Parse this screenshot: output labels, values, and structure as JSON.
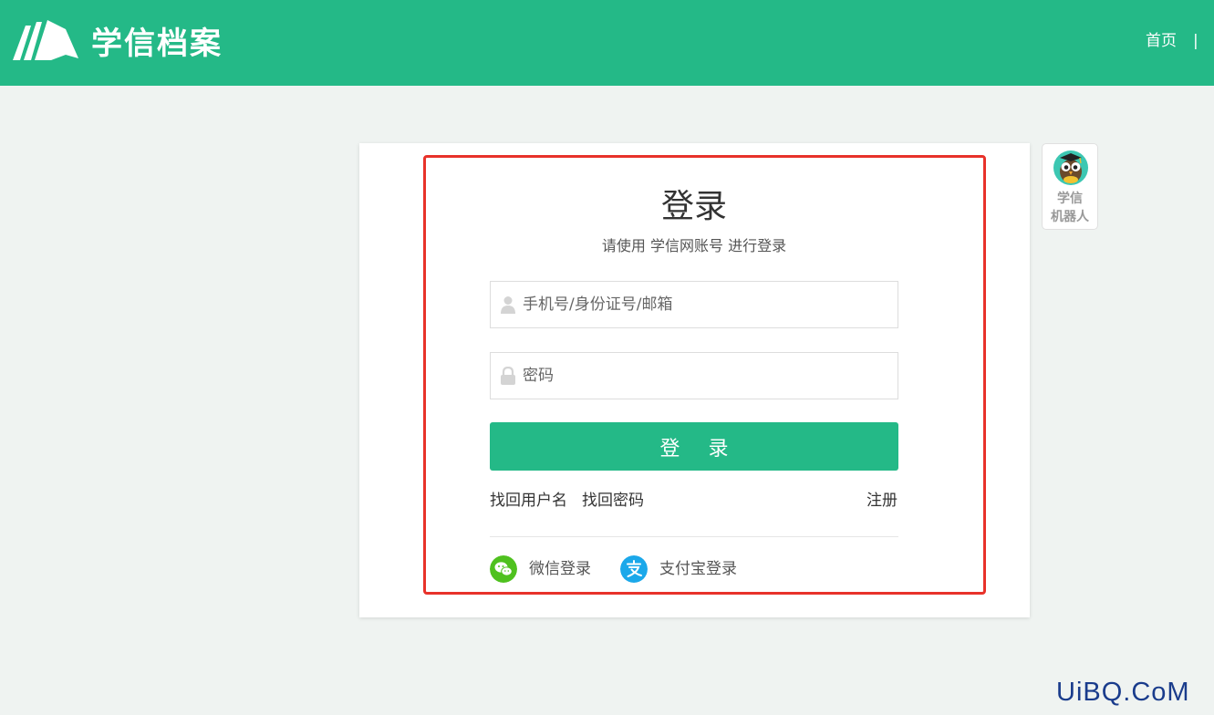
{
  "header": {
    "brand": "学信档案",
    "nav_home": "首页",
    "nav_separator": "|",
    "background_color": "#24b987"
  },
  "login": {
    "title": "登录",
    "subtitle": "请使用 学信网账号 进行登录",
    "username_placeholder": "手机号/身份证号/邮箱",
    "password_placeholder": "密码",
    "submit_label": "登 录",
    "find_username": "找回用户名",
    "find_password": "找回密码",
    "register": "注册",
    "wechat_login": "微信登录",
    "alipay_login": "支付宝登录",
    "accent_color": "#24b987",
    "highlight_color": "#e8322a"
  },
  "robot": {
    "label_line1": "学信",
    "label_line2": "机器人"
  },
  "watermark": "UiBQ.CoM",
  "icons": {
    "logo": "book-pages-logo",
    "username": "user-icon",
    "password": "lock-icon",
    "wechat": "wechat-icon",
    "alipay": "alipay-icon",
    "robot": "owl-robot-icon"
  }
}
